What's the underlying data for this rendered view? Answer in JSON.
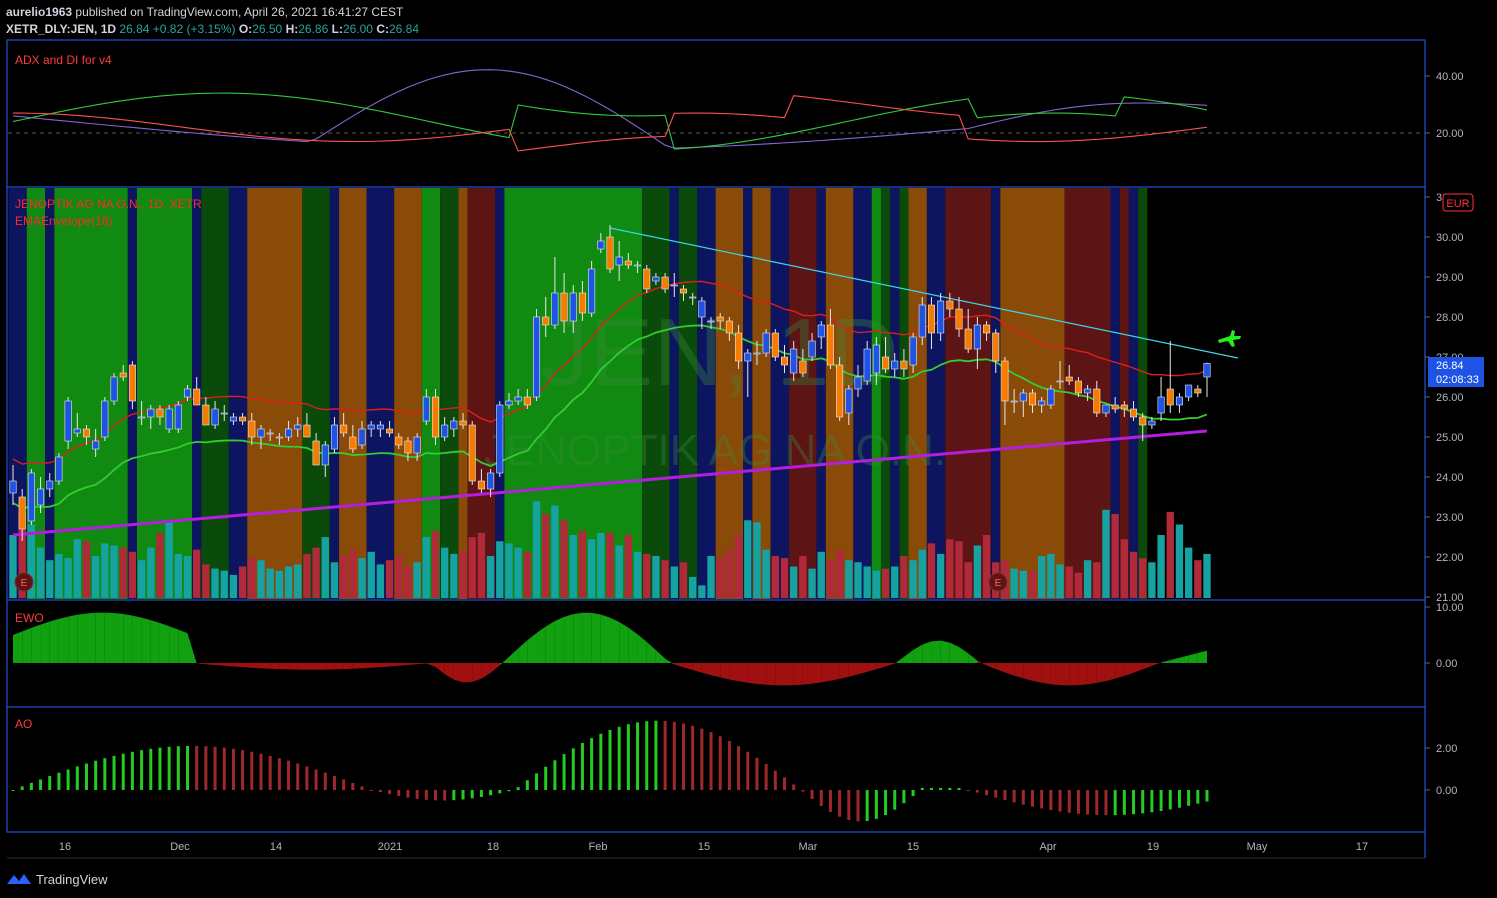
{
  "header": {
    "author": "aurelio1963",
    "published_text": "published on TradingView.com, April 26, 2021 16:41:27 CEST",
    "symbol": "XETR_DLY:JEN, 1D",
    "last": "26.84",
    "change": "+0.82 (+3.15%)",
    "o_label": "O:",
    "o": "26.50",
    "h_label": "H:",
    "h": "26.86",
    "l_label": "L:",
    "l": "26.00",
    "c_label": "C:",
    "c": "26.84"
  },
  "panes": {
    "adx": {
      "title": "ADX and DI for v4",
      "ticks": [
        "40.00",
        "20.00"
      ]
    },
    "main": {
      "title": "JENOPTIK AG NA O.N., 1D, XETR",
      "indicator": "EMAEnvelope(18)",
      "watermark_symbol": "JEN, 1D",
      "watermark_name": "JENOPTIK AG NA O.N.",
      "currency": "EUR",
      "last_price": "26.84",
      "countdown": "02:08:33",
      "ticks": [
        "31.00",
        "30.00",
        "29.00",
        "28.00",
        "27.00",
        "26.00",
        "25.00",
        "24.00",
        "23.00",
        "22.00",
        "21.00"
      ],
      "earnings_marker": "E"
    },
    "ewo": {
      "title": "EWO",
      "ticks": [
        "10.00",
        "0.00"
      ]
    },
    "ao": {
      "title": "AO",
      "ticks": [
        "2.00",
        "0.00"
      ]
    }
  },
  "x_axis": {
    "labels": [
      "16",
      "Dec",
      "14",
      "2021",
      "18",
      "Feb",
      "15",
      "Mar",
      "15",
      "Apr",
      "19",
      "May",
      "17"
    ]
  },
  "footer": {
    "brand": "TradingView"
  },
  "colors": {
    "bg": "#000000",
    "grid_border": "#2962ff",
    "up": "#1e53e5",
    "down": "#f57c00",
    "ema_red": "#e01e1e",
    "ema_green": "#33cc33",
    "ma_purple": "#b41edc",
    "trendline": "#3fd6e8",
    "adx_green": "#2ecc40",
    "adx_red": "#ff5050",
    "adx_purple": "#8a63d2",
    "bg_green": "#108a10",
    "bg_darkgreen": "#0a4a0a",
    "bg_navy": "#0d1561",
    "bg_orange": "#8a4a08",
    "bg_maroon": "#5c1414"
  },
  "chart_data": {
    "type": "candlestick",
    "title": "JENOPTIK AG NA O.N., 1D, XETR",
    "x_range": [
      "2020-11-10",
      "2021-04-26"
    ],
    "ylim": [
      21.0,
      31.0
    ],
    "last": {
      "open": 26.5,
      "high": 26.86,
      "low": 26.0,
      "close": 26.84
    },
    "ohlc": [
      [
        23.6,
        24.3,
        23.3,
        23.9
      ],
      [
        23.5,
        23.7,
        22.4,
        22.7
      ],
      [
        22.9,
        24.2,
        22.8,
        24.1
      ],
      [
        23.3,
        24.0,
        23.1,
        23.7
      ],
      [
        23.7,
        24.1,
        23.5,
        23.9
      ],
      [
        23.9,
        24.6,
        23.8,
        24.5
      ],
      [
        24.9,
        26.0,
        24.7,
        25.9
      ],
      [
        25.1,
        25.6,
        25.0,
        25.2
      ],
      [
        25.2,
        25.3,
        24.8,
        25.0
      ],
      [
        24.7,
        25.2,
        24.5,
        24.9
      ],
      [
        25.0,
        26.0,
        24.9,
        25.9
      ],
      [
        25.9,
        26.6,
        25.8,
        26.5
      ],
      [
        26.6,
        26.8,
        26.4,
        26.5
      ],
      [
        26.8,
        26.9,
        25.7,
        25.9
      ],
      [
        25.5,
        25.9,
        25.3,
        25.5
      ],
      [
        25.5,
        25.8,
        25.2,
        25.7
      ],
      [
        25.7,
        25.8,
        25.3,
        25.5
      ],
      [
        25.2,
        25.8,
        25.1,
        25.7
      ],
      [
        25.2,
        25.9,
        25.1,
        25.8
      ],
      [
        26.0,
        26.3,
        25.9,
        26.2
      ],
      [
        26.2,
        26.5,
        25.8,
        25.8
      ],
      [
        25.8,
        26.0,
        25.3,
        25.3
      ],
      [
        25.3,
        25.9,
        25.2,
        25.7
      ],
      [
        25.6,
        25.8,
        25.4,
        25.6
      ],
      [
        25.4,
        25.6,
        25.3,
        25.5
      ],
      [
        25.5,
        25.6,
        25.3,
        25.4
      ],
      [
        25.4,
        25.6,
        24.8,
        25.0
      ],
      [
        25.0,
        25.3,
        24.7,
        25.2
      ],
      [
        25.1,
        25.2,
        24.9,
        25.1
      ],
      [
        25.0,
        25.1,
        24.8,
        25.0
      ],
      [
        25.0,
        25.4,
        24.9,
        25.2
      ],
      [
        25.2,
        25.5,
        25.0,
        25.3
      ],
      [
        25.3,
        25.6,
        25.0,
        25.0
      ],
      [
        24.9,
        25.1,
        24.3,
        24.3
      ],
      [
        24.3,
        24.9,
        24.0,
        24.8
      ],
      [
        24.7,
        25.5,
        24.6,
        25.3
      ],
      [
        25.3,
        25.6,
        25.0,
        25.1
      ],
      [
        25.0,
        25.3,
        24.6,
        24.7
      ],
      [
        24.8,
        25.4,
        24.7,
        25.2
      ],
      [
        25.2,
        25.4,
        25.0,
        25.3
      ],
      [
        25.2,
        25.4,
        25.0,
        25.3
      ],
      [
        25.2,
        25.4,
        25.0,
        25.1
      ],
      [
        25.0,
        25.1,
        24.7,
        24.8
      ],
      [
        24.9,
        25.0,
        24.4,
        24.6
      ],
      [
        24.6,
        25.1,
        24.4,
        25.0
      ],
      [
        25.4,
        26.2,
        25.3,
        26.0
      ],
      [
        26.0,
        26.2,
        24.8,
        25.0
      ],
      [
        25.0,
        25.5,
        24.9,
        25.3
      ],
      [
        25.2,
        25.5,
        25.0,
        25.4
      ],
      [
        25.4,
        25.6,
        25.2,
        25.3
      ],
      [
        25.3,
        25.4,
        23.8,
        23.9
      ],
      [
        23.9,
        24.2,
        23.6,
        23.7
      ],
      [
        23.7,
        24.2,
        23.5,
        24.1
      ],
      [
        24.1,
        25.9,
        24.0,
        25.8
      ],
      [
        25.8,
        26.1,
        25.7,
        25.9
      ],
      [
        25.9,
        26.2,
        25.8,
        26.0
      ],
      [
        26.0,
        26.2,
        25.7,
        25.8
      ],
      [
        26.0,
        28.2,
        25.9,
        28.0
      ],
      [
        28.0,
        28.5,
        27.5,
        27.8
      ],
      [
        27.8,
        29.5,
        27.7,
        28.6
      ],
      [
        28.6,
        29.1,
        27.6,
        27.9
      ],
      [
        27.9,
        28.8,
        27.6,
        28.6
      ],
      [
        28.6,
        28.9,
        27.9,
        28.1
      ],
      [
        28.1,
        29.4,
        28.0,
        29.2
      ],
      [
        29.7,
        30.1,
        29.6,
        29.9
      ],
      [
        30.0,
        30.3,
        29.1,
        29.2
      ],
      [
        29.3,
        29.9,
        28.9,
        29.5
      ],
      [
        29.4,
        29.6,
        29.2,
        29.3
      ],
      [
        29.3,
        29.4,
        29.1,
        29.3
      ],
      [
        29.2,
        29.3,
        28.6,
        28.7
      ],
      [
        28.9,
        29.1,
        28.8,
        29.0
      ],
      [
        29.0,
        29.1,
        28.6,
        28.7
      ],
      [
        28.8,
        29.1,
        28.5,
        28.8
      ],
      [
        28.7,
        28.8,
        28.4,
        28.6
      ],
      [
        28.5,
        28.6,
        28.3,
        28.5
      ],
      [
        28.0,
        28.5,
        27.7,
        28.4
      ],
      [
        27.9,
        28.0,
        27.7,
        27.9
      ],
      [
        28.0,
        28.1,
        27.7,
        27.9
      ],
      [
        27.9,
        28.0,
        27.4,
        27.6
      ],
      [
        27.6,
        27.8,
        26.7,
        26.9
      ],
      [
        26.9,
        27.2,
        26.0,
        27.1
      ],
      [
        27.1,
        27.4,
        26.8,
        27.1
      ],
      [
        27.1,
        27.7,
        27.0,
        27.6
      ],
      [
        27.6,
        27.7,
        26.9,
        27.0
      ],
      [
        27.0,
        27.3,
        26.6,
        26.8
      ],
      [
        26.6,
        27.4,
        26.4,
        27.2
      ],
      [
        26.9,
        27.2,
        26.5,
        26.6
      ],
      [
        27.0,
        27.6,
        26.9,
        27.4
      ],
      [
        27.5,
        27.9,
        27.2,
        27.8
      ],
      [
        27.8,
        28.2,
        26.7,
        26.8
      ],
      [
        26.8,
        27.0,
        25.4,
        25.5
      ],
      [
        25.6,
        26.3,
        25.3,
        26.2
      ],
      [
        26.2,
        26.8,
        26.0,
        26.5
      ],
      [
        26.4,
        27.4,
        26.3,
        27.2
      ],
      [
        26.6,
        27.5,
        26.3,
        27.3
      ],
      [
        27.0,
        27.5,
        26.6,
        26.7
      ],
      [
        26.7,
        27.1,
        26.5,
        26.9
      ],
      [
        26.9,
        27.2,
        26.5,
        26.7
      ],
      [
        26.8,
        27.6,
        26.6,
        27.5
      ],
      [
        27.5,
        28.5,
        27.3,
        28.3
      ],
      [
        28.3,
        28.5,
        27.2,
        27.6
      ],
      [
        27.6,
        28.6,
        27.4,
        28.4
      ],
      [
        28.4,
        28.6,
        28.0,
        28.2
      ],
      [
        28.2,
        28.5,
        27.5,
        27.7
      ],
      [
        27.7,
        28.2,
        27.1,
        27.2
      ],
      [
        27.2,
        28.0,
        26.7,
        27.8
      ],
      [
        27.8,
        27.9,
        27.4,
        27.6
      ],
      [
        27.6,
        27.7,
        26.6,
        26.9
      ],
      [
        26.9,
        27.0,
        25.3,
        25.9
      ],
      [
        25.9,
        26.2,
        25.6,
        25.9
      ],
      [
        25.9,
        26.2,
        25.5,
        26.1
      ],
      [
        26.1,
        26.2,
        25.6,
        25.8
      ],
      [
        25.8,
        26.0,
        25.6,
        25.9
      ],
      [
        25.8,
        26.3,
        25.7,
        26.2
      ],
      [
        26.4,
        26.9,
        26.2,
        26.4
      ],
      [
        26.5,
        26.8,
        26.3,
        26.4
      ],
      [
        26.4,
        26.5,
        26.0,
        26.1
      ],
      [
        26.1,
        26.3,
        25.9,
        26.2
      ],
      [
        26.2,
        26.4,
        25.5,
        25.6
      ],
      [
        25.6,
        25.8,
        25.5,
        25.8
      ],
      [
        25.8,
        26.0,
        25.6,
        25.7
      ],
      [
        25.8,
        25.9,
        25.5,
        25.7
      ],
      [
        25.7,
        25.9,
        25.4,
        25.5
      ],
      [
        25.5,
        25.6,
        24.9,
        25.3
      ],
      [
        25.3,
        25.5,
        25.2,
        25.4
      ],
      [
        25.6,
        26.5,
        25.4,
        26.0
      ],
      [
        26.2,
        27.4,
        25.6,
        25.8
      ],
      [
        25.8,
        26.1,
        25.6,
        26.0
      ],
      [
        26.0,
        26.3,
        25.9,
        26.3
      ],
      [
        26.2,
        26.3,
        26.0,
        26.1
      ],
      [
        26.5,
        26.86,
        26.0,
        26.84
      ]
    ]
  }
}
